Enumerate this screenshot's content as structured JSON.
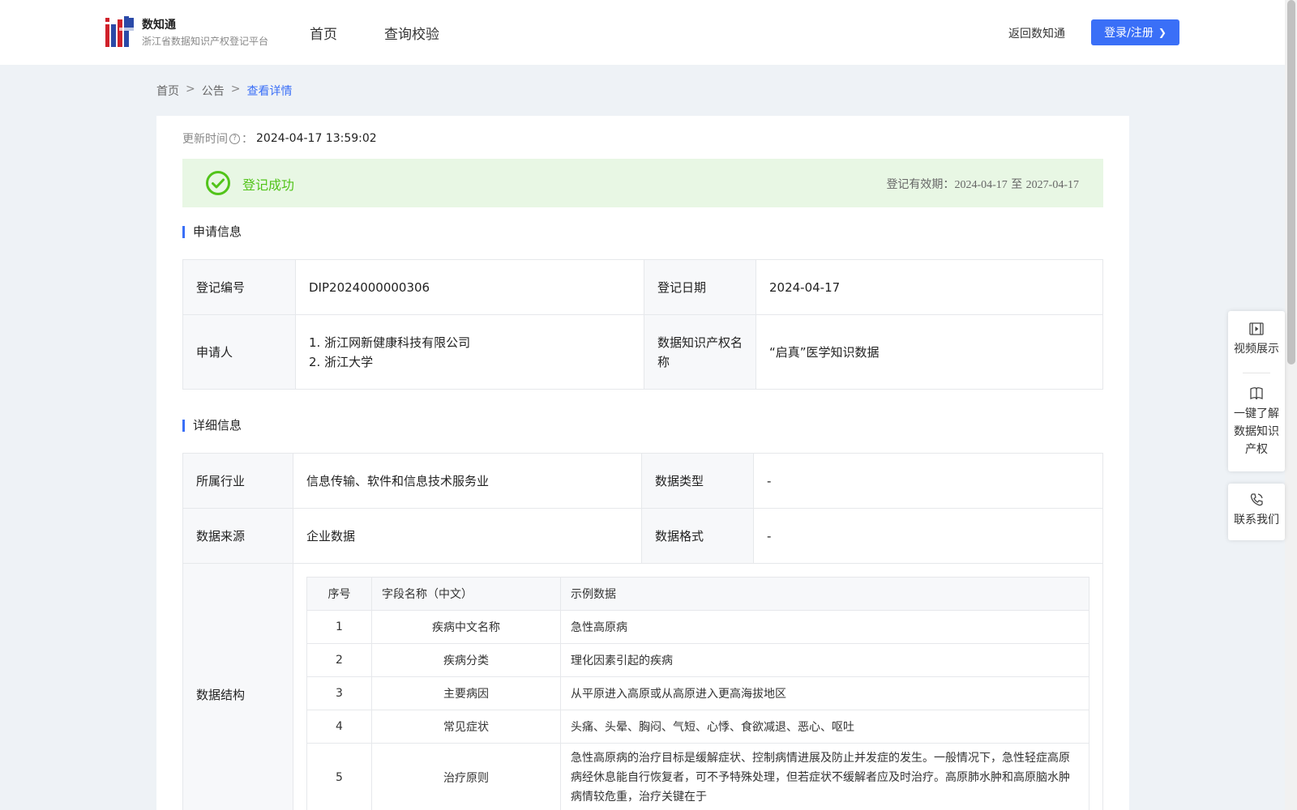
{
  "header": {
    "brand_name": "数知通",
    "brand_sub": "浙江省数据知识产权登记平台",
    "nav": [
      "首页",
      "查询校验"
    ],
    "back_link": "返回数知通",
    "login_label": "登录/注册"
  },
  "breadcrumb": [
    "首页",
    "公告",
    "查看详情"
  ],
  "update": {
    "label": "更新时间",
    "value": "2024-04-17 13:59:02"
  },
  "status": {
    "text": "登记成功",
    "validity_label": "登记有效期：",
    "start": "2024-04-17",
    "to": "至",
    "end": "2027-04-17"
  },
  "apply_section": {
    "title": "申请信息",
    "reg_no_label": "登记编号",
    "reg_no": "DIP2024000000306",
    "reg_date_label": "登记日期",
    "reg_date": "2024-04-17",
    "applicant_label": "申请人",
    "applicants": [
      "1. 浙江网新健康科技有限公司",
      "2. 浙江大学"
    ],
    "ip_name_label": "数据知识产权名称",
    "ip_name": "“启真”医学知识数据"
  },
  "detail_section": {
    "title": "详细信息",
    "industry_label": "所属行业",
    "industry": "信息传输、软件和信息技术服务业",
    "data_type_label": "数据类型",
    "data_type": "-",
    "source_label": "数据来源",
    "source": "企业数据",
    "format_label": "数据格式",
    "format": "-",
    "structure_label": "数据结构",
    "structure_headers": [
      "序号",
      "字段名称（中文）",
      "示例数据"
    ],
    "structure_rows": [
      {
        "idx": "1",
        "name": "疾病中文名称",
        "example": "急性高原病"
      },
      {
        "idx": "2",
        "name": "疾病分类",
        "example": "理化因素引起的疾病"
      },
      {
        "idx": "3",
        "name": "主要病因",
        "example": "从平原进入高原或从高原进入更高海拔地区"
      },
      {
        "idx": "4",
        "name": "常见症状",
        "example": "头痛、头晕、胸闷、气短、心悸、食欲减退、恶心、呕吐"
      },
      {
        "idx": "5",
        "name": "治疗原则",
        "example": "急性高原病的治疗目标是缓解症状、控制病情进展及防止并发症的发生。一般情况下，急性轻症高原病经休息能自行恢复者，可不予特殊处理，但若症状不缓解者应及时治疗。高原肺水肿和高原脑水肿病情较危重，治疗关键在于"
      }
    ]
  },
  "float_menu": {
    "video": "视频展示",
    "learn": "一键了解数据知识产权",
    "contact": "联系我们"
  },
  "colors": {
    "accent": "#3a6ff7",
    "success": "#52c41a",
    "success_bg": "#e8f7e4"
  }
}
